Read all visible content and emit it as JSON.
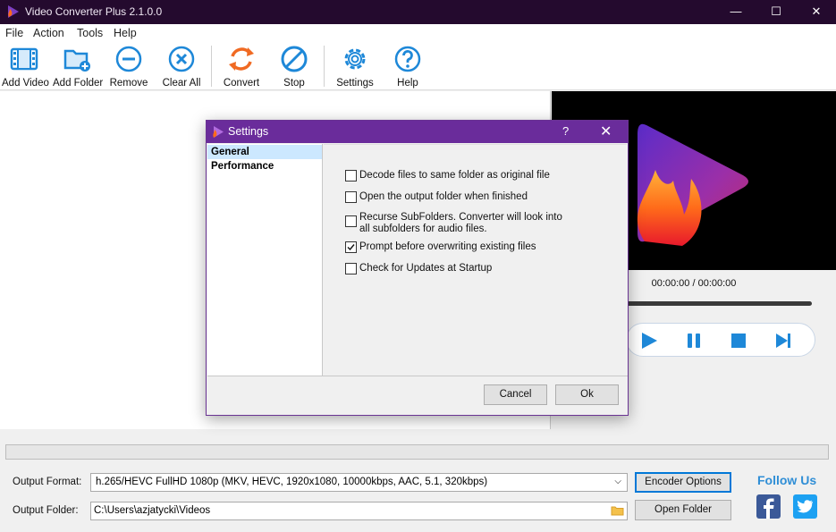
{
  "window": {
    "title": "Video Converter Plus 2.1.0.0",
    "minimize": "—",
    "maximize": "☐",
    "close": "✕"
  },
  "menu": [
    "File",
    "Action",
    "Tools",
    "Help"
  ],
  "toolbar": {
    "add_video": "Add Video",
    "add_folder": "Add Folder",
    "remove": "Remove",
    "clear_all": "Clear All",
    "convert": "Convert",
    "stop": "Stop",
    "settings": "Settings",
    "help": "Help"
  },
  "player": {
    "timecode": "00:00:00 / 00:00:00"
  },
  "output": {
    "format_label": "Output Format:",
    "format_value": "h.265/HEVC FullHD 1080p (MKV, HEVC, 1920x1080, 10000kbps, AAC, 5.1, 320kbps)",
    "folder_label": "Output Folder:",
    "folder_value": "C:\\Users\\azjatycki\\Videos",
    "encoder_options": "Encoder Options",
    "open_folder": "Open Folder"
  },
  "social": {
    "follow_us": "Follow Us",
    "facebook": "facebook-icon",
    "twitter": "twitter-icon"
  },
  "dialog": {
    "title": "Settings",
    "help": "?",
    "close": "✕",
    "nav": [
      "General",
      "Performance"
    ],
    "selected_nav": "General",
    "options": [
      {
        "label": "Decode files to same folder as original file",
        "checked": false
      },
      {
        "label": "Open the output folder when finished",
        "checked": false
      },
      {
        "label": "Recurse SubFolders. Converter will look into all subfolders for audio files.",
        "checked": false
      },
      {
        "label": "Prompt before overwriting existing files",
        "checked": true
      },
      {
        "label": "Check for Updates at Startup",
        "checked": false
      }
    ],
    "cancel": "Cancel",
    "ok": "Ok"
  },
  "colors": {
    "titlebar": "#240a2e",
    "dialog_title": "#6a2c9b",
    "accent_blue": "#1e88d8",
    "convert_orange": "#f06a23",
    "follow_blue": "#2f8ed6"
  }
}
